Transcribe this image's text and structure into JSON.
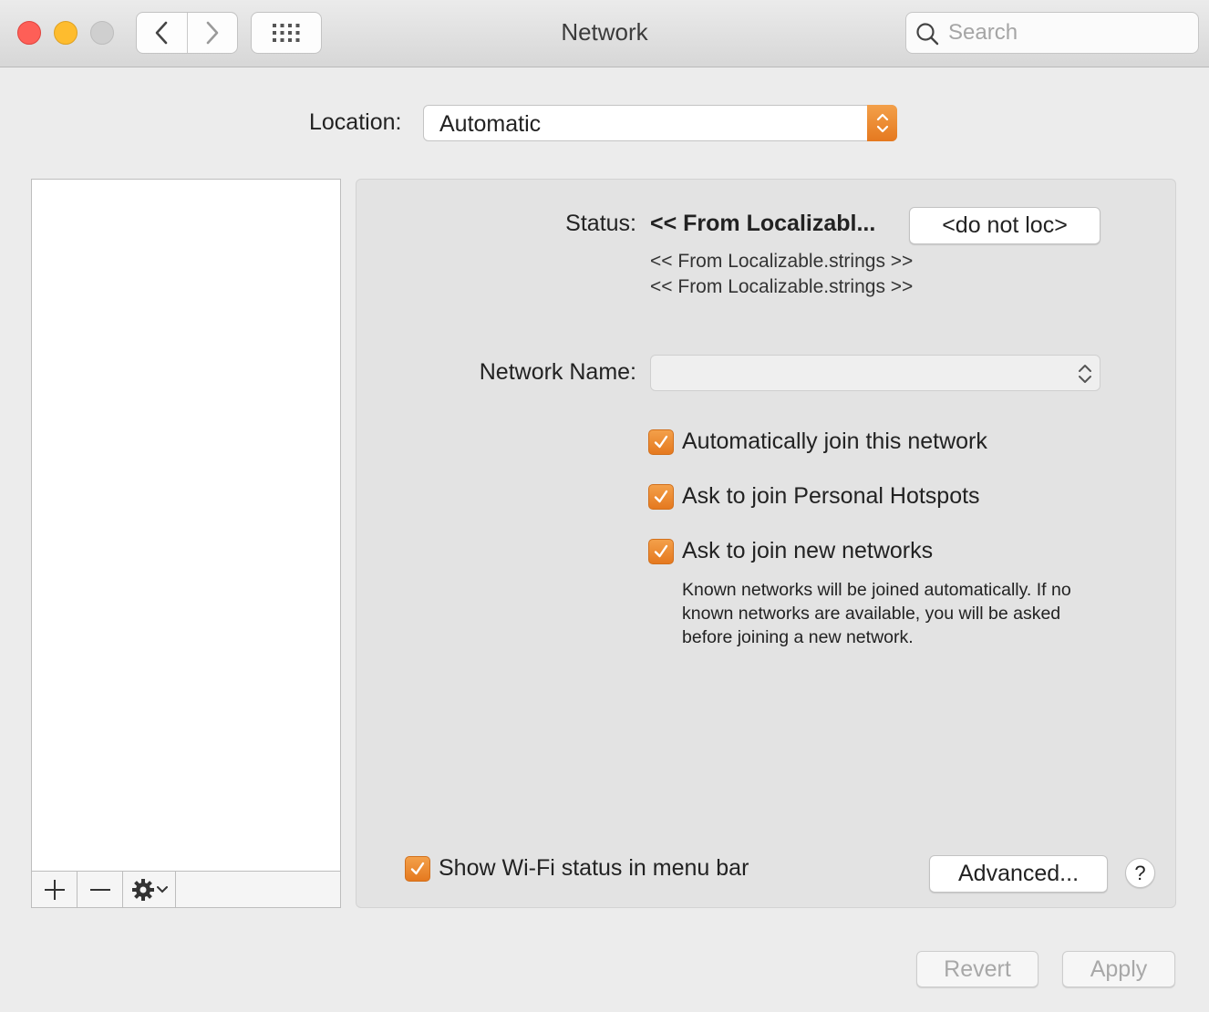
{
  "window": {
    "title": "Network"
  },
  "search": {
    "placeholder": "Search"
  },
  "location": {
    "label": "Location:",
    "value": "Automatic"
  },
  "status": {
    "label": "Status:",
    "value": "<< From Localizabl...",
    "button_label": "<do not loc>",
    "lines": [
      "<< From Localizable.strings >>",
      "<< From Localizable.strings >>"
    ]
  },
  "network_name": {
    "label": "Network Name:",
    "value": ""
  },
  "options": [
    {
      "label": "Automatically join this network",
      "checked": true
    },
    {
      "label": "Ask to join Personal Hotspots",
      "checked": true
    },
    {
      "label": "Ask to join new networks",
      "checked": true
    }
  ],
  "hint": "Known networks will be joined automatically. If no known networks are available, you will be asked before joining a new network.",
  "show_wifi_status": {
    "label": "Show Wi-Fi status in menu bar",
    "checked": true
  },
  "advanced_button": "Advanced...",
  "help_button": "?",
  "revert_button": "Revert",
  "apply_button": "Apply",
  "colors": {
    "accent": "#ea8a2f",
    "window_bg": "#ececec",
    "panel_bg": "#e3e3e3"
  },
  "icons": [
    "close-icon",
    "minimize-icon",
    "zoom-icon",
    "chevron-left-icon",
    "chevron-right-icon",
    "grid-icon",
    "search-icon",
    "up-down-arrows-icon",
    "checkmark-icon",
    "plus-icon",
    "minus-icon",
    "gear-icon",
    "chevron-down-icon"
  ]
}
